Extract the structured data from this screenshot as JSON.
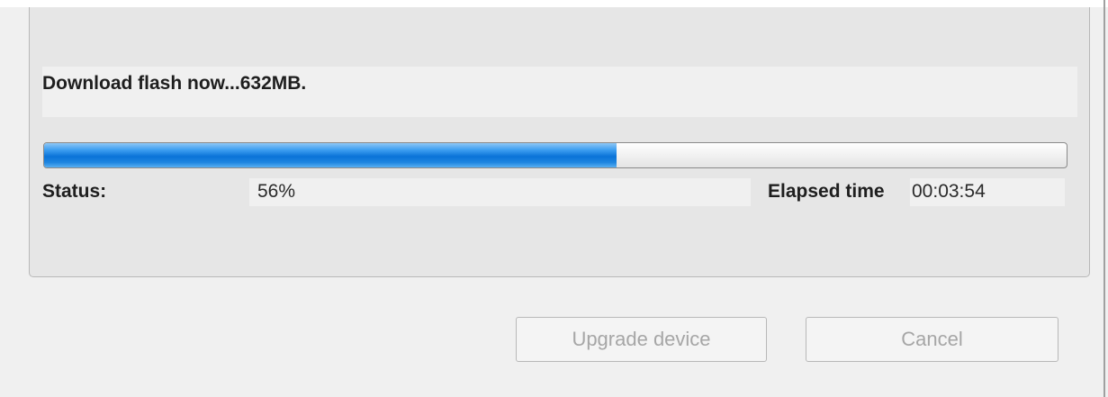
{
  "message": "Download flash now...632MB.",
  "progress": {
    "percent": 56,
    "fill_color": "#0a73d8"
  },
  "status": {
    "label": "Status:",
    "value": "56%"
  },
  "elapsed": {
    "label": "Elapsed time",
    "value": "00:03:54"
  },
  "buttons": {
    "upgrade_label": "Upgrade device",
    "cancel_label": "Cancel",
    "enabled": false
  }
}
